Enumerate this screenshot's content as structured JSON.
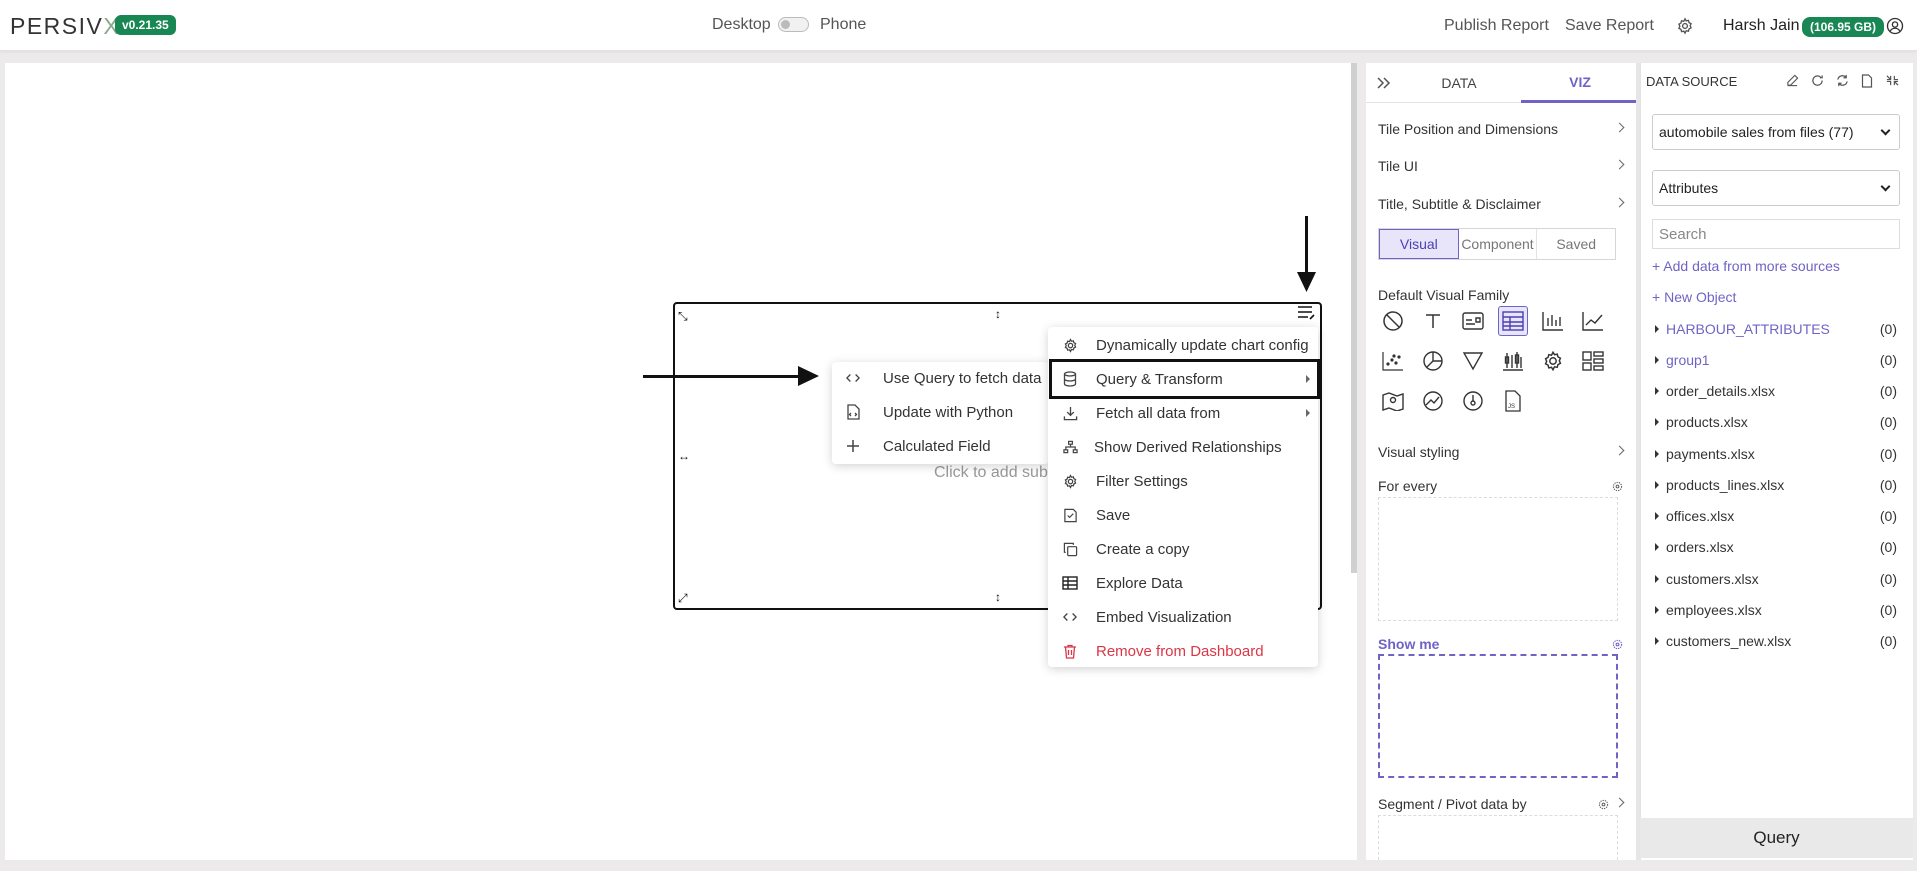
{
  "header": {
    "logo_main": "PERSIV",
    "logo_x": "X",
    "version": "v0.21.35",
    "layout_desktop": "Desktop",
    "layout_phone": "Phone",
    "publish_label": "Publish Report",
    "save_label": "Save Report",
    "user_name": "Harsh Jain",
    "storage": "(106.95 GB)"
  },
  "tile": {
    "subtitle_placeholder": "Click to add subtit"
  },
  "tile_menu": {
    "items": [
      {
        "label": "Dynamically update chart config",
        "icon": "gear-icon"
      },
      {
        "label": "Query & Transform",
        "icon": "database-icon"
      },
      {
        "label": "Fetch all data from",
        "icon": "download-icon"
      },
      {
        "label": "Show Derived Relationships",
        "icon": "hierarchy-icon"
      },
      {
        "label": "Filter Settings",
        "icon": "gear-icon"
      },
      {
        "label": "Save",
        "icon": "save-icon"
      },
      {
        "label": "Create a copy",
        "icon": "copy-icon"
      },
      {
        "label": "Explore Data",
        "icon": "table-icon"
      },
      {
        "label": "Embed Visualization",
        "icon": "code-icon"
      },
      {
        "label": "Remove from Dashboard",
        "icon": "trash-icon"
      }
    ]
  },
  "query_submenu": {
    "items": [
      {
        "label": "Use Query to fetch data",
        "icon": "code-icon"
      },
      {
        "label": "Update with Python",
        "icon": "file-code-icon"
      },
      {
        "label": "Calculated Field",
        "icon": "plus-icon"
      }
    ]
  },
  "viz_panel": {
    "tab_data": "DATA",
    "tab_viz": "VIZ",
    "sections": {
      "tile_position": "Tile Position and Dimensions",
      "tile_ui": "Tile UI",
      "title_subtitle": "Title, Subtitle & Disclaimer"
    },
    "segments": [
      "Visual",
      "Component",
      "Saved"
    ],
    "visual_family_label": "Default Visual Family",
    "visual_styling": "Visual styling",
    "for_every": "For every",
    "show_me": "Show me",
    "segment_pivot": "Segment / Pivot data by",
    "colors": {
      "accent": "#6f64c5"
    }
  },
  "data_source": {
    "title": "DATA SOURCE",
    "source_value": "automobile sales from files (77)",
    "attribute_value": "Attributes",
    "search_placeholder": "Search",
    "add_data": "Add data from more sources",
    "new_object": "New Object",
    "objects": [
      {
        "name": "HARBOUR_ATTRIBUTES",
        "count": "(0)"
      },
      {
        "name": "group1",
        "count": "(0)"
      },
      {
        "name": "order_details.xlsx",
        "count": "(0)"
      },
      {
        "name": "products.xlsx",
        "count": "(0)"
      },
      {
        "name": "payments.xlsx",
        "count": "(0)"
      },
      {
        "name": "products_lines.xlsx",
        "count": "(0)"
      },
      {
        "name": "offices.xlsx",
        "count": "(0)"
      },
      {
        "name": "orders.xlsx",
        "count": "(0)"
      },
      {
        "name": "customers.xlsx",
        "count": "(0)"
      },
      {
        "name": "employees.xlsx",
        "count": "(0)"
      },
      {
        "name": "customers_new.xlsx",
        "count": "(0)"
      }
    ],
    "query_button": "Query"
  }
}
